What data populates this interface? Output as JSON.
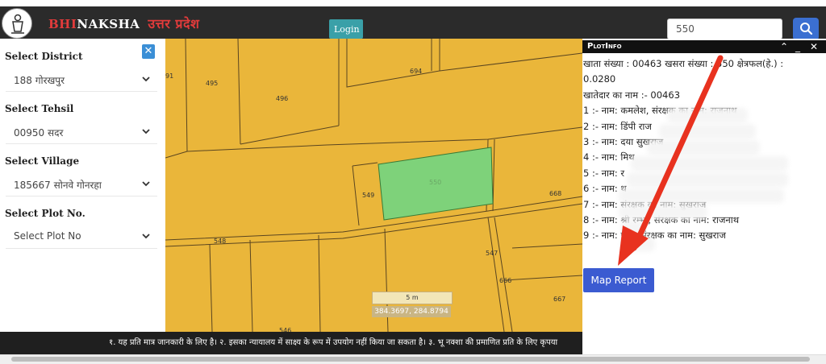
{
  "header": {
    "brand_part1": "BHI",
    "brand_part2": "NAKSHA",
    "brand_state": "उत्तर प्रदेश",
    "login_label": "Login",
    "search_value": "550",
    "colors": {
      "topbar": "#2b2b2b",
      "brand_red": "#e23b3b",
      "login": "#3aa0a8",
      "search_button": "#3b6fd1"
    }
  },
  "sidebar": {
    "district_label": "Select District",
    "district_value": "188 गोरखपुर",
    "tehsil_label": "Select Tehsil",
    "tehsil_value": "00950 सदर",
    "village_label": "Select Village",
    "village_value": "185667 सोनवे गोनरहा",
    "plot_label": "Select Plot No.",
    "plot_placeholder": "Select Plot No",
    "close_icon": "close-icon"
  },
  "map": {
    "plot_labels": [
      "495",
      "496",
      "694",
      "549",
      "550",
      "548",
      "668",
      "666",
      "667",
      "546",
      "547"
    ],
    "partial_label": "91",
    "scale_label": "5 m",
    "coordinates": "384.3697, 284.8794",
    "colors": {
      "parcel": "#eab63a",
      "selected": "#7ed27a",
      "line": "#5a4520"
    }
  },
  "plotinfo": {
    "title": "PlotInfo",
    "lines": [
      "खाता संख्या : 00463 खसरा संख्या : 550 क्षेत्रफल(हे.) :",
      "0.0280",
      "खातेदार का नाम :- 00463",
      "1 :- नाम: कमलेश, संरक्षक का नाम: राजनाथ",
      "2 :- नाम: डिंपी                                राज",
      "3 :- नाम: दया                                  सुखराज",
      "4 :- नाम: मिथ",
      "5 :- नाम: र",
      "6 :- नाम:                                              थ",
      "7 :- नाम:                      संरक्षक का नाम: सुखराज",
      "8 :- नाम: श्री      रम्भा, संरक्षक का नाम: राजनाथ",
      "9 :- नाम:          पाल, संरक्षक का नाम: सुखराज"
    ],
    "map_report_label": "Map Report"
  },
  "ticker": {
    "text": "१. यह प्रति मात्र जानकारी के लिए है। २. इसका न्यायालय में साक्ष्य के रूप में उपयोग नहीं किया जा सकता है। ३. भू नक्शा की प्रमाणित प्रति के लिए कृपया"
  }
}
